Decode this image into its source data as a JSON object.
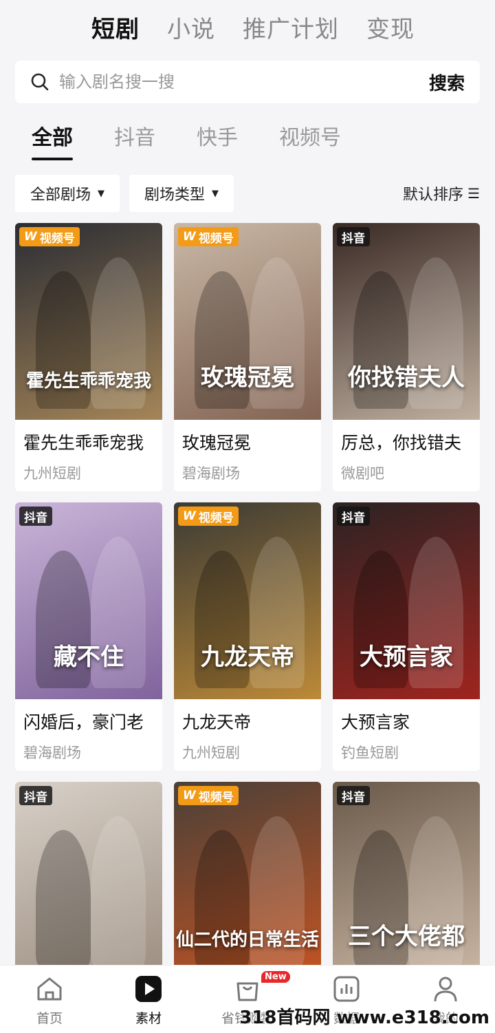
{
  "top_tabs": [
    "短剧",
    "小说",
    "推广计划",
    "变现"
  ],
  "search": {
    "placeholder": "输入剧名搜一搜",
    "button": "搜索"
  },
  "sub_tabs": [
    "全部",
    "抖音",
    "快手",
    "视频号"
  ],
  "filters": {
    "theater": "全部剧场",
    "type": "剧场类型",
    "sort": "默认排序"
  },
  "dramas": [
    {
      "title": "霍先生乖乖宠我",
      "theater": "九州短剧",
      "platform": "视频号",
      "poster_text": "霍先生乖乖宠我",
      "bg": "#2a2c33",
      "accent": "#c9a063"
    },
    {
      "title": "玫瑰冠冕",
      "theater": "碧海剧场",
      "platform": "视频号",
      "poster_text": "玫瑰冠冕",
      "bg": "#c9b8a6",
      "accent": "#6e4a3a"
    },
    {
      "title": "厉总，你找错夫",
      "theater": "微剧吧",
      "platform": "抖音",
      "poster_text": "你找错夫人",
      "bg": "#3a2a25",
      "accent": "#e7d8c5"
    },
    {
      "title": "闪婚后，豪门老",
      "theater": "碧海剧场",
      "platform": "抖音",
      "poster_text": "藏不住",
      "bg": "#c9b5d8",
      "accent": "#6a4b8a"
    },
    {
      "title": "九龙天帝",
      "theater": "九州短剧",
      "platform": "视频号",
      "poster_text": "九龙天帝",
      "bg": "#3b3a34",
      "accent": "#e3a23a"
    },
    {
      "title": "大预言家",
      "theater": "钓鱼短剧",
      "platform": "抖音",
      "poster_text": "大预言家",
      "bg": "#2b2323",
      "accent": "#c2241d"
    },
    {
      "title": "",
      "theater": "",
      "platform": "抖音",
      "poster_text": "",
      "bg": "#d8d0c8",
      "accent": "#8a7a6a"
    },
    {
      "title": "",
      "theater": "",
      "platform": "视频号",
      "poster_text": "仙二代的日常生活",
      "bg": "#4a4038",
      "accent": "#e85a1c"
    },
    {
      "title": "",
      "theater": "",
      "platform": "抖音",
      "poster_text": "三个大佬都",
      "bg": "#6a5a4a",
      "accent": "#e9d3c0"
    }
  ],
  "bottom_nav": [
    {
      "label": "首页",
      "icon": "home-icon"
    },
    {
      "label": "素材",
      "icon": "play-icon",
      "active": true
    },
    {
      "label": "省钱购物",
      "icon": "shopping-bag-icon",
      "badge": "New"
    },
    {
      "label": "数据",
      "icon": "bar-chart-icon"
    },
    {
      "label": "我的",
      "icon": "user-icon"
    }
  ],
  "watermark": "318首码网 www.e318.com"
}
